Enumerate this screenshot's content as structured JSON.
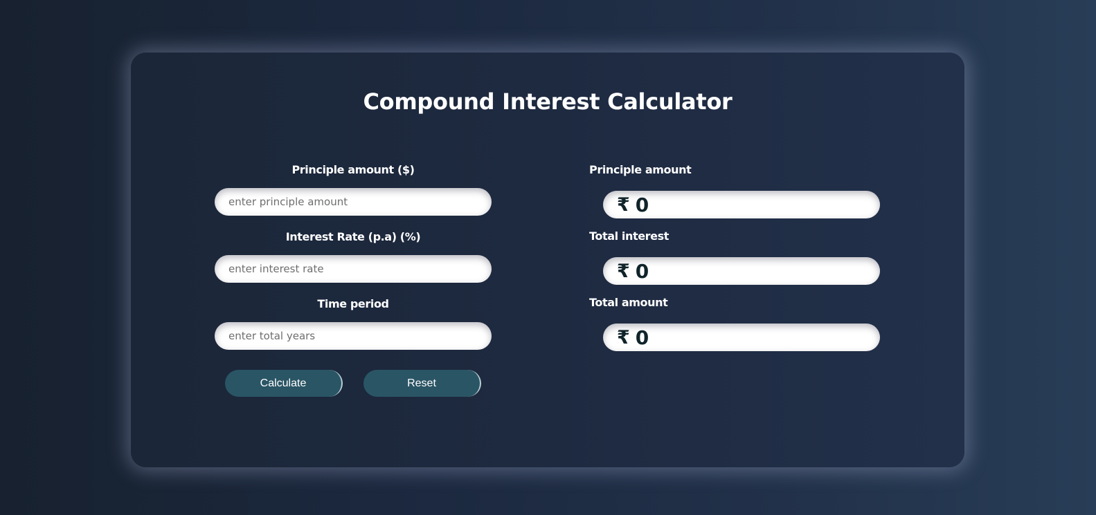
{
  "app": {
    "title": "Compound Interest Calculator"
  },
  "form": {
    "principal": {
      "label": "Principle amount ($)",
      "placeholder": "enter principle amount",
      "value": ""
    },
    "rate": {
      "label": "Interest Rate (p.a) (%)",
      "placeholder": "enter interest rate",
      "value": ""
    },
    "time": {
      "label": "Time period",
      "placeholder": "enter total years",
      "value": ""
    },
    "buttons": {
      "calculate": "Calculate",
      "reset": "Reset"
    }
  },
  "results": {
    "currency_symbol": "₹",
    "principal": {
      "label": "Principle amount",
      "value": "0"
    },
    "interest": {
      "label": "Total interest",
      "value": "0"
    },
    "total": {
      "label": "Total amount",
      "value": "0"
    }
  },
  "colors": {
    "button_bg": "#2a5565",
    "result_text": "#10242a",
    "card_glow": "#aab4d7"
  }
}
